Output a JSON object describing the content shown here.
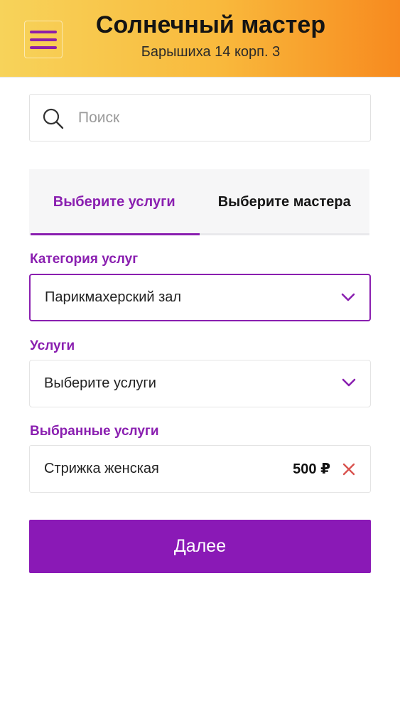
{
  "header": {
    "title": "Солнечный мастер",
    "subtitle": "Барышиха 14 корп. 3"
  },
  "search": {
    "placeholder": "Поиск",
    "value": ""
  },
  "tabs": [
    {
      "label": "Выберите услуги",
      "active": true
    },
    {
      "label": "Выберите мастера",
      "active": false
    }
  ],
  "category": {
    "label": "Категория услуг",
    "selected": "Парикмахерский зал"
  },
  "services": {
    "label": "Услуги",
    "selected": "Выберите услуги"
  },
  "selected_services": {
    "label": "Выбранные услуги",
    "items": [
      {
        "name": "Стрижка женская",
        "price": "500 ₽"
      }
    ]
  },
  "next_button": {
    "label": "Далее"
  },
  "colors": {
    "accent": "#8a1fb0",
    "button": "#8a19b6",
    "header_gradient_start": "#f7d35a",
    "header_gradient_end": "#f78a1f",
    "remove": "#d9534f"
  },
  "icons": {
    "menu": "hamburger-menu-icon",
    "search": "search-icon",
    "dropdown": "chevron-down-icon",
    "remove": "close-icon"
  }
}
